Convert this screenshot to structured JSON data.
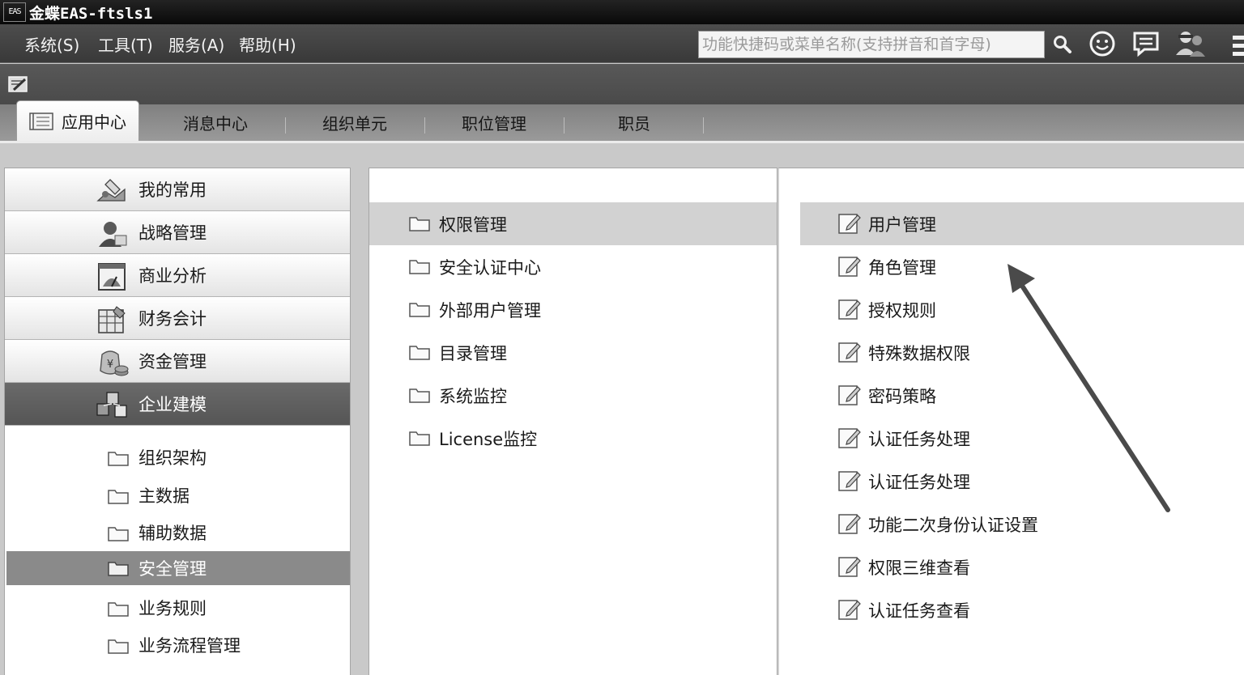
{
  "window": {
    "logo_text": "EAS",
    "title": "金蝶EAS-ftsls1"
  },
  "menubar": {
    "items": [
      "系统(S)",
      "工具(T)",
      "服务(A)",
      "帮助(H)"
    ]
  },
  "search": {
    "placeholder": "功能快捷码或菜单名称(支持拼音和首字母)"
  },
  "toolbar_icons": [
    "search-icon",
    "smiley-icon",
    "message-icon",
    "user-group-icon"
  ],
  "tabs": [
    {
      "label": "应用中心",
      "active": true
    },
    {
      "label": "消息中心",
      "active": false
    },
    {
      "label": "组织单元",
      "active": false
    },
    {
      "label": "职位管理",
      "active": false
    },
    {
      "label": "职员",
      "active": false
    }
  ],
  "categories": [
    {
      "label": "我的常用",
      "icon": "favorites-icon",
      "active": false
    },
    {
      "label": "战略管理",
      "icon": "strategy-icon",
      "active": false
    },
    {
      "label": "商业分析",
      "icon": "analysis-icon",
      "active": false
    },
    {
      "label": "财务会计",
      "icon": "accounting-icon",
      "active": false
    },
    {
      "label": "资金管理",
      "icon": "fund-icon",
      "active": false
    },
    {
      "label": "企业建模",
      "icon": "modeling-icon",
      "active": true
    }
  ],
  "sub_items": [
    {
      "label": "组织架构",
      "active": false
    },
    {
      "label": "主数据",
      "active": false
    },
    {
      "label": "辅助数据",
      "active": false
    },
    {
      "label": "安全管理",
      "active": true
    },
    {
      "label": "业务规则",
      "active": false
    },
    {
      "label": "业务流程管理",
      "active": false
    }
  ],
  "modules": [
    {
      "label": "权限管理",
      "active": true
    },
    {
      "label": "安全认证中心",
      "active": false
    },
    {
      "label": "外部用户管理",
      "active": false
    },
    {
      "label": "目录管理",
      "active": false
    },
    {
      "label": "系统监控",
      "active": false
    },
    {
      "label": "License监控",
      "active": false
    }
  ],
  "functions": [
    {
      "label": "用户管理",
      "active": true
    },
    {
      "label": "角色管理",
      "active": false
    },
    {
      "label": "授权规则",
      "active": false
    },
    {
      "label": "特殊数据权限",
      "active": false
    },
    {
      "label": "密码策略",
      "active": false
    },
    {
      "label": "认证任务处理",
      "active": false
    },
    {
      "label": "认证任务处理",
      "active": false
    },
    {
      "label": "功能二次身份认证设置",
      "active": false
    },
    {
      "label": "权限三维查看",
      "active": false
    },
    {
      "label": "认证任务查看",
      "active": false
    }
  ]
}
